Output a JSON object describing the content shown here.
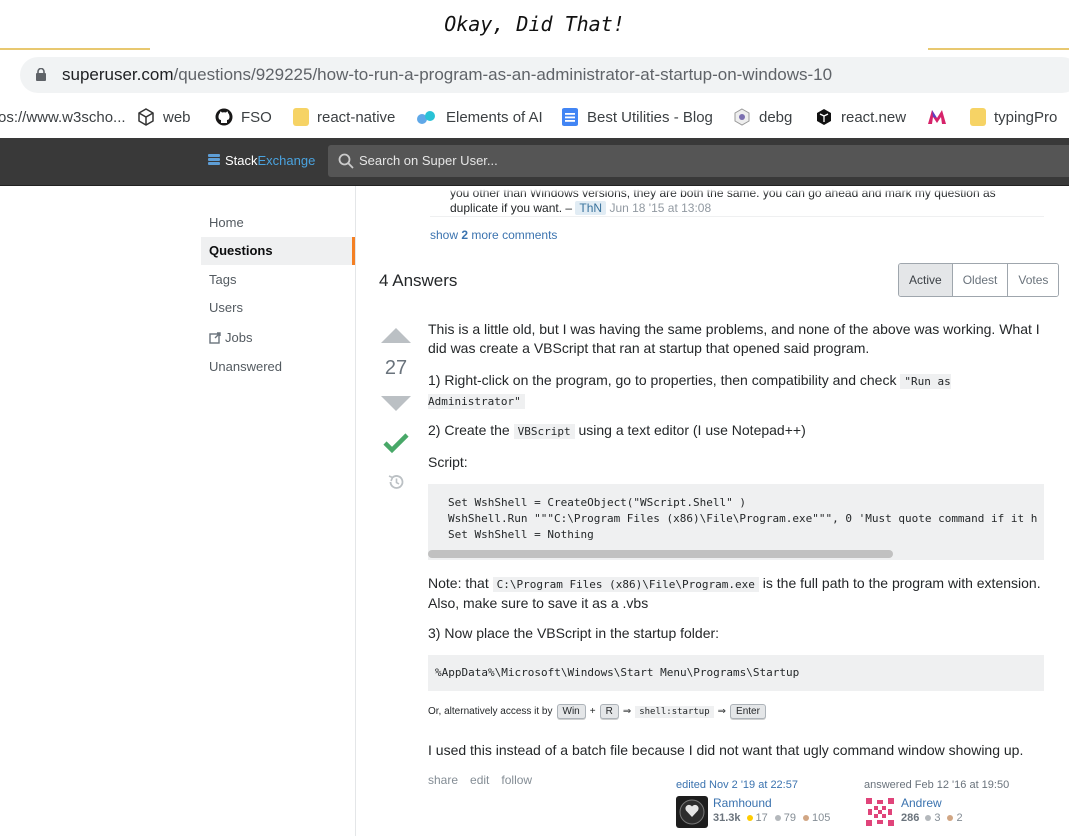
{
  "caption": "Okay, Did That!",
  "browser": {
    "url_host": "superuser.com",
    "url_path": "/questions/929225/how-to-run-a-program-as-an-administrator-at-startup-on-windows-10",
    "bookmarks": [
      {
        "label": "os://www.w3scho...",
        "icon": "w3-icon"
      },
      {
        "label": "web",
        "icon": "cube-icon"
      },
      {
        "label": "FSO",
        "icon": "github-icon"
      },
      {
        "label": "react-native",
        "icon": "folder-icon"
      },
      {
        "label": "Elements of AI",
        "icon": "dots-icon"
      },
      {
        "label": "Best Utilities - Blog",
        "icon": "doc-icon"
      },
      {
        "label": "debg",
        "icon": "eye-icon"
      },
      {
        "label": "react.new",
        "icon": "codesandbox-icon"
      },
      {
        "label": "",
        "icon": "m-logo-icon"
      },
      {
        "label": "typingPro",
        "icon": "folder-icon"
      }
    ]
  },
  "topbar": {
    "logo_stack": "Stack",
    "logo_exchange": "Exchange",
    "search_placeholder": "Search on Super User..."
  },
  "nav": {
    "home": "Home",
    "questions": "Questions",
    "tags": "Tags",
    "users": "Users",
    "jobs": "Jobs",
    "unanswered": "Unanswered"
  },
  "comment": {
    "line1": "you other than Windows versions, they are both the same. you can go ahead and mark my question as",
    "line2": "duplicate if you want. –",
    "user": "ThN",
    "date": "Jun 18 '15 at 13:08",
    "show_prefix": "show",
    "show_count": "2",
    "show_suffix": "more comments"
  },
  "answers": {
    "count_label": "4 Answers",
    "sort": [
      "Active",
      "Oldest",
      "Votes"
    ]
  },
  "answer": {
    "votes": "27",
    "p1": "This is a little old, but I was having the same problems, and none of the above was working. What I did was create a VBScript that ran at startup that opened said program.",
    "p2_text": "1) Right-click on the program, go to properties, then compatibility and check",
    "p2_code": "\"Run as Administrator\"",
    "p3_pre": "2) Create the",
    "p3_code": "VBScript",
    "p3_post": "using a text editor (I use Notepad++)",
    "p4": "Script:",
    "code_block": "Set WshShell = CreateObject(\"WScript.Shell\" )\nWshShell.Run \"\"\"C:\\Program Files (x86)\\File\\Program.exe\"\"\", 0 'Must quote command if it h\nSet WshShell = Nothing",
    "note_pre": "Note: that",
    "note_code": "C:\\Program Files (x86)\\File\\Program.exe",
    "note_post": "is the full path to the program with extension. Also, make sure to save it as a .vbs",
    "p5": "3) Now place the VBScript in the startup folder:",
    "path_block": "%AppData%\\Microsoft\\Windows\\Start Menu\\Programs\\Startup",
    "alt_text": "Or, alternatively access it by",
    "kbd_win": "Win",
    "kbd_plus": "+",
    "kbd_r": "R",
    "arrow1": "⇒",
    "kbd_cmd": "shell:startup",
    "arrow2": "⇒",
    "kbd_enter": "Enter",
    "p6": "I used this instead of a batch file because I did not want that ugly command window showing up.",
    "menu": [
      "share",
      "edit",
      "follow"
    ],
    "editor": {
      "action": "edited Nov 2 '19 at 22:57",
      "name": "Ramhound",
      "rep": "31.3k",
      "gold": "17",
      "silver": "79",
      "bronze": "105"
    },
    "author": {
      "action": "answered Feb 12 '16 at 19:50",
      "name": "Andrew",
      "rep": "286",
      "silver": "3",
      "bronze": "2"
    }
  },
  "colors": {
    "accent_orange": "#f48024",
    "link_blue": "#3b73af",
    "accepted_green": "#48a868",
    "gold": "#ffcc01",
    "silver": "#b4b8bc",
    "bronze": "#d1a684"
  }
}
